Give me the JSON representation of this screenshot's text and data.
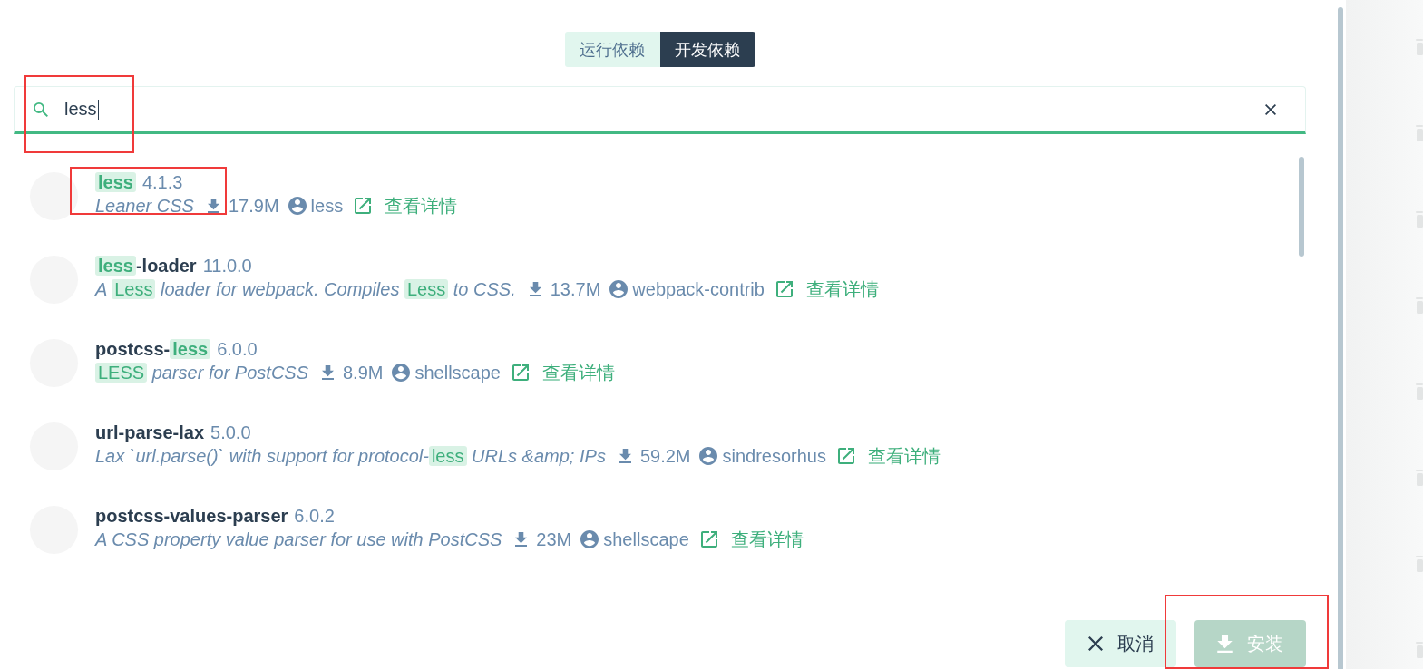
{
  "tabs": [
    {
      "label": "运行依赖",
      "selected": false
    },
    {
      "label": "开发依赖",
      "selected": true
    }
  ],
  "search": {
    "value": "less",
    "focused": true,
    "annotated": true
  },
  "packages": [
    {
      "name": [
        {
          "text": "less",
          "match": true
        }
      ],
      "version": "4.1.3",
      "description": [
        {
          "text": "Leaner CSS",
          "match": false
        }
      ],
      "downloads": "17.9M",
      "author": "less",
      "link": "查看详情",
      "annotated": true
    },
    {
      "name": [
        {
          "text": "less",
          "match": true
        },
        {
          "text": "-loader",
          "match": false
        }
      ],
      "version": "11.0.0",
      "description": [
        {
          "text": "A ",
          "match": false
        },
        {
          "text": "Less",
          "match": true
        },
        {
          "text": " loader for webpack. Compiles ",
          "match": false
        },
        {
          "text": "Less",
          "match": true
        },
        {
          "text": " to CSS.",
          "match": false
        }
      ],
      "downloads": "13.7M",
      "author": "webpack-contrib",
      "link": "查看详情",
      "annotated": false
    },
    {
      "name": [
        {
          "text": "postcss-",
          "match": false
        },
        {
          "text": "less",
          "match": true
        }
      ],
      "version": "6.0.0",
      "description": [
        {
          "text": "LESS",
          "match": true
        },
        {
          "text": " parser for PostCSS",
          "match": false
        }
      ],
      "downloads": "8.9M",
      "author": "shellscape",
      "link": "查看详情",
      "annotated": false
    },
    {
      "name": [
        {
          "text": "url-parse-lax",
          "match": false
        }
      ],
      "version": "5.0.0",
      "description": [
        {
          "text": "Lax `url.parse()` with support for protocol-",
          "match": false
        },
        {
          "text": "less",
          "match": true
        },
        {
          "text": " URLs &amp; IPs",
          "match": false
        }
      ],
      "downloads": "59.2M",
      "author": "sindresorhus",
      "link": "查看详情",
      "annotated": false
    },
    {
      "name": [
        {
          "text": "postcss-values-parser",
          "match": false
        }
      ],
      "version": "6.0.2",
      "description": [
        {
          "text": "A CSS property value parser for use with PostCSS",
          "match": false
        }
      ],
      "downloads": "23M",
      "author": "shellscape",
      "link": "查看详情",
      "annotated": false
    }
  ],
  "buttons": [
    {
      "kind": "cancel",
      "label": "取消",
      "disabled": false,
      "annotated": false
    },
    {
      "kind": "install",
      "label": "安装",
      "disabled": true,
      "annotated": true
    }
  ]
}
